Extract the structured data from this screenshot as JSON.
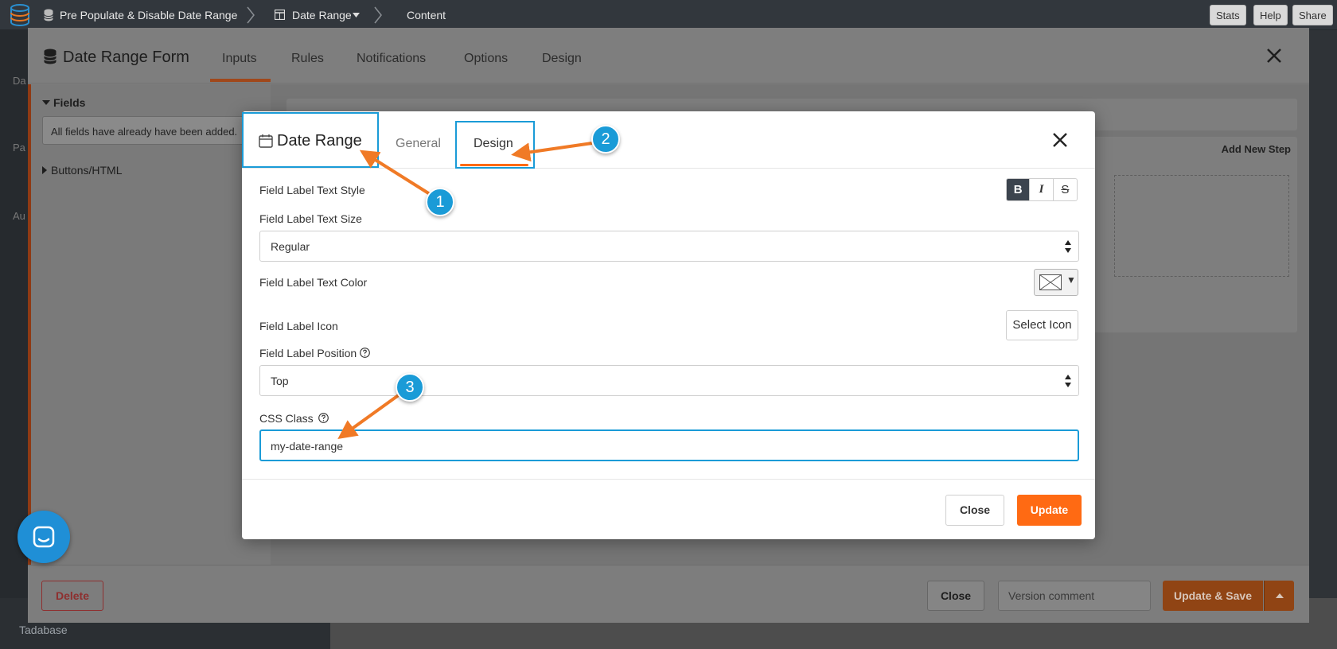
{
  "topbar": {
    "app_name": "Pre Populate & Disable Date Range",
    "crumb_table": "Date Range",
    "crumb_page": "Content",
    "buttons": [
      "Stats",
      "Help",
      "Share"
    ]
  },
  "background": {
    "sidebar_fragments": [
      "Da",
      "Pa",
      "Au"
    ],
    "brand": "Tadabase"
  },
  "form_modal": {
    "title": "Date Range Form",
    "tabs": [
      "Inputs",
      "Rules",
      "Notifications",
      "Options",
      "Design"
    ],
    "active_tab": "Inputs",
    "fields_heading": "Fields",
    "fields_notice": "All fields have already have been added.",
    "buttons_html": "Buttons/HTML",
    "add_new_step": "Add New Step",
    "footer": {
      "delete": "Delete",
      "close": "Close",
      "version_placeholder": "Version comment",
      "update_save": "Update & Save"
    }
  },
  "field_modal": {
    "title": "Date Range",
    "tabs": [
      "General",
      "Design"
    ],
    "active_tab": "Design",
    "label_text_style": "Field Label Text Style",
    "style_buttons": [
      "B",
      "I",
      "S"
    ],
    "label_text_size": "Field Label Text Size",
    "label_text_size_value": "Regular",
    "label_text_color": "Field Label Text Color",
    "label_icon": "Field Label Icon",
    "select_icon": "Select Icon",
    "label_position": "Field Label Position",
    "label_position_value": "Top",
    "css_class_label": "CSS Class",
    "css_class_value": "my-date-range",
    "close": "Close",
    "update": "Update"
  },
  "annotations": [
    "1",
    "2",
    "3"
  ],
  "colors": {
    "accent_orange": "#ff6a13",
    "highlight_blue": "#1a9bd7",
    "topbar": "#32373d"
  }
}
